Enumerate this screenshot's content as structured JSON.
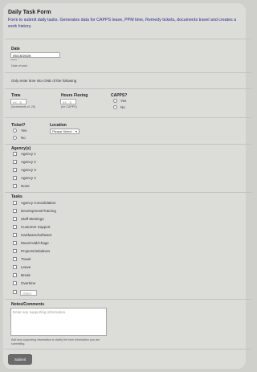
{
  "form": {
    "title": "Daily Task Form",
    "description": "Form to submit daily tasks. Generates data for CAPPS leave, PPM time, Remedy tickets, documents travel and creates a work history."
  },
  "date": {
    "label": "Date",
    "value": "05/16/2026",
    "help": "Date of work"
  },
  "time_note": "Only enter time into ONE of the following",
  "time": {
    "label": "Time",
    "placeholder": "ex: .5",
    "help": "(increments of .25)"
  },
  "hours_flexing": {
    "label": "Hours Flexing",
    "placeholder": "ex: .5",
    "help": "(for CAPPS)"
  },
  "capps": {
    "label": "CAPPS?",
    "options": [
      "Yes",
      "No"
    ]
  },
  "ticket": {
    "label": "Ticket?",
    "options": [
      "Yes",
      "No"
    ]
  },
  "location": {
    "label": "Location",
    "selected": "Please Select"
  },
  "agencies": {
    "label": "Agency(s)",
    "items": [
      "Agency 1",
      "Agency 2",
      "Agency 3",
      "Agency 4",
      "None"
    ]
  },
  "tasks": {
    "label": "Tasks",
    "items": [
      "Agency Consolidation",
      "Development/Training",
      "Staff Meetings",
      "Customer Support",
      "Hardware/Software",
      "Move/Add/Chage",
      "Projects/Initiatives",
      "Travel",
      "Leave",
      "Break",
      "Overtime"
    ],
    "other_placeholder": "Other"
  },
  "notes": {
    "label": "Notes/Comments",
    "placeholder": "Enter any supporting information.",
    "help": "Add any supporting information to clarify the form information you are submitting."
  },
  "submit": {
    "label": "Submit"
  }
}
